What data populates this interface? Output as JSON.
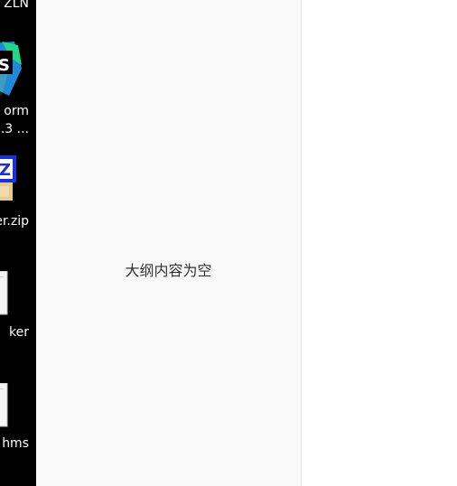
{
  "desktop": {
    "items": [
      {
        "label_lines": [
          "ZLN"
        ],
        "icon": "app-icon"
      },
      {
        "label_lines": [
          "orm",
          ".3 ..."
        ],
        "icon": "webstorm-icon"
      },
      {
        "label_lines": [
          "er.zip"
        ],
        "icon": "zip-archive-icon"
      },
      {
        "label_lines": [
          "ker"
        ],
        "icon": "file-icon"
      },
      {
        "label_lines": [
          "hms"
        ],
        "icon": "file-icon"
      }
    ]
  },
  "outline": {
    "empty_text": "大纲内容为空"
  },
  "colors": {
    "desktop_bg": "#000000",
    "outline_bg": "#f9f9f9",
    "editor_bg": "#ffffff"
  }
}
